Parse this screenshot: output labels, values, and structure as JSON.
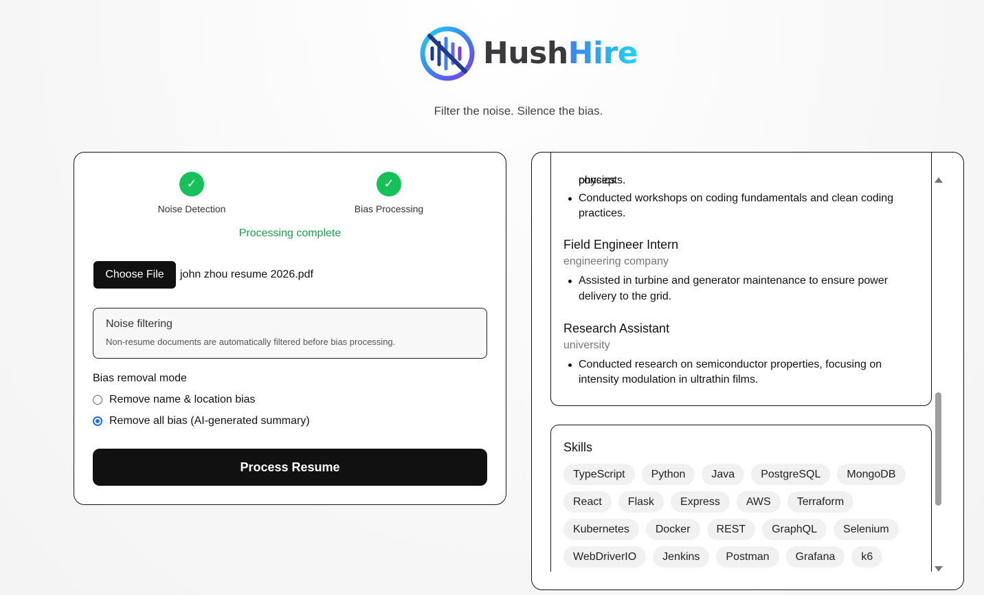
{
  "brand": {
    "name_part1": "Hush",
    "name_part2": "Hire",
    "tagline": "Filter the noise. Silence the bias."
  },
  "colors": {
    "accent_blue": "#3b82f6",
    "accent_cyan": "#22d3ee",
    "success_green": "#16c15a",
    "status_text": "#16a34a",
    "primary_button": "#111111",
    "radio_selected": "#1a73e8"
  },
  "steps": [
    {
      "label": "Noise Detection",
      "status": "complete",
      "icon": "check-icon"
    },
    {
      "label": "Bias Processing",
      "status": "complete",
      "icon": "check-icon"
    }
  ],
  "status_message": "Processing complete",
  "file_input": {
    "button_label": "Choose File",
    "file_name": "john zhou resume 2026.pdf"
  },
  "noise_filtering": {
    "title": "Noise filtering",
    "description": "Non-resume documents are automatically filtered before bias processing."
  },
  "bias_mode": {
    "label": "Bias removal mode",
    "options": [
      {
        "label": "Remove name & location bias",
        "selected": false
      },
      {
        "label": "Remove all bias (AI-generated summary)",
        "selected": true
      }
    ]
  },
  "process_button": "Process Resume",
  "experience": {
    "partial_bullet_top": "Guided students in building functional robots and taught core physics",
    "partial_bullet_cont": "concepts.",
    "bullet_workshops_line1": "Conducted workshops on coding fundamentals and clean coding",
    "bullet_workshops_line2": "practices.",
    "jobs": [
      {
        "title": "Field Engineer Intern",
        "org": "engineering company",
        "bullet_line1": "Assisted in turbine and generator maintenance to ensure power",
        "bullet_line2": "delivery to the grid."
      },
      {
        "title": "Research Assistant",
        "org": "university",
        "bullet_line1": "Conducted research on semiconductor properties, focusing on",
        "bullet_line2": "intensity modulation in ultrathin films."
      }
    ]
  },
  "skills": {
    "title": "Skills",
    "items": [
      "TypeScript",
      "Python",
      "Java",
      "PostgreSQL",
      "MongoDB",
      "React",
      "Flask",
      "Express",
      "AWS",
      "Terraform",
      "Kubernetes",
      "Docker",
      "REST",
      "GraphQL",
      "Selenium",
      "WebDriverIO",
      "Jenkins",
      "Postman",
      "Grafana",
      "k6"
    ]
  }
}
